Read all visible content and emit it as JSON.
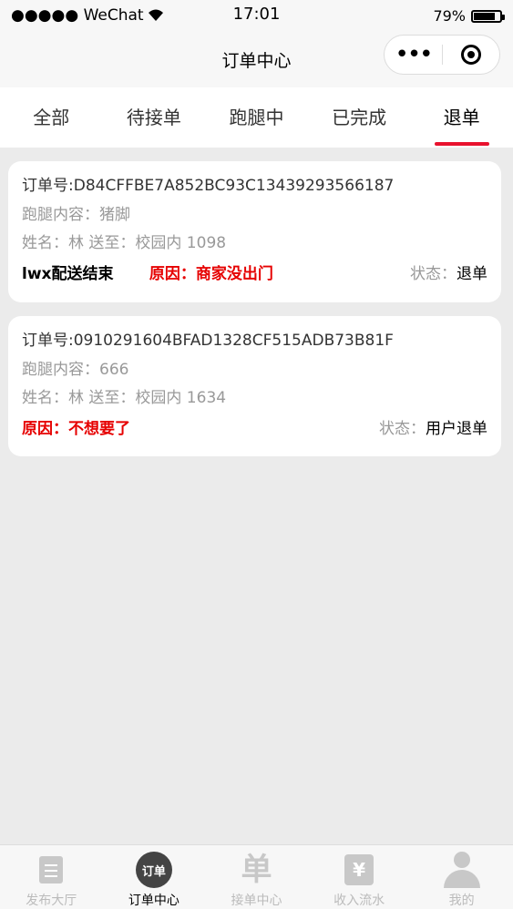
{
  "status_bar": {
    "carrier": "●●●●● WeChat",
    "time": "17:01",
    "battery": "79%",
    "battery_level": 0.79
  },
  "navbar": {
    "title": "订单中心",
    "menu_dots": "•••"
  },
  "tabs": [
    {
      "label": "全部",
      "active": false
    },
    {
      "label": "待接单",
      "active": false
    },
    {
      "label": "跑腿中",
      "active": false
    },
    {
      "label": "已完成",
      "active": false
    },
    {
      "label": "退单",
      "active": true
    }
  ],
  "orders": [
    {
      "order_no": "订单号:D84CFFBE7A852BC93C13439293566187",
      "content": "跑腿内容：猪脚",
      "info": "姓名：林 送至：校园内 1098",
      "note": "lwx配送结束",
      "reason": "原因：商家没出门",
      "state_label": "状态：",
      "state_value": "退单"
    },
    {
      "order_no": "订单号:0910291604BFAD1328CF515ADB73B81F",
      "content": "跑腿内容：666",
      "info": "姓名：林 送至：校园内 1634",
      "reason": "原因：不想要了",
      "state_label": "状态：",
      "state_value": "用户退单"
    }
  ],
  "tabbar": [
    {
      "label": "发布大厅",
      "icon": "document-icon"
    },
    {
      "label": "订单中心",
      "icon": "order-icon",
      "icon_text": "订单",
      "active": true
    },
    {
      "label": "接单中心",
      "icon": "dan-icon",
      "icon_text": "单"
    },
    {
      "label": "收入流水",
      "icon": "yen-icon",
      "icon_text": "¥"
    },
    {
      "label": "我的",
      "icon": "user-icon"
    }
  ],
  "colors": {
    "accent": "#e8112d",
    "reason": "#e60000",
    "background": "#ebebeb"
  }
}
